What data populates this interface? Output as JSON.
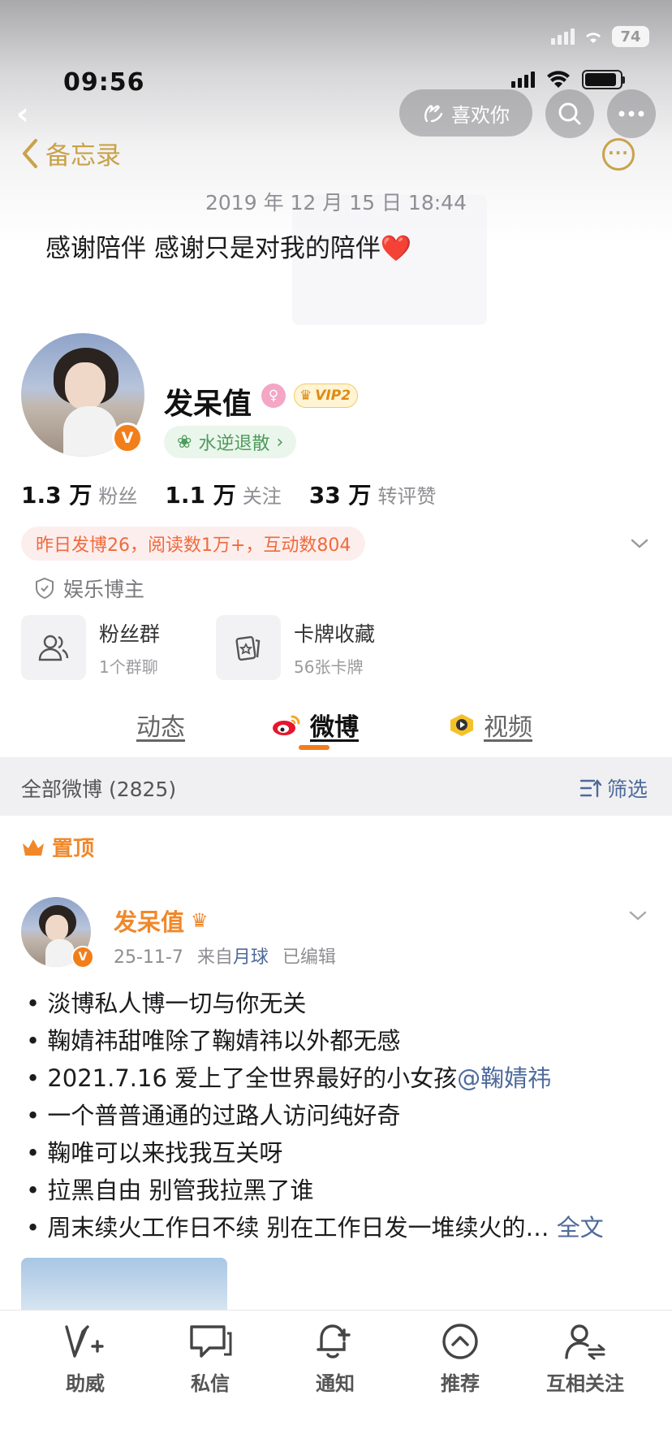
{
  "status_bar": {
    "time": "09:56",
    "battery_bg": "74"
  },
  "overlay_buttons": {
    "like_label": "喜欢你"
  },
  "memo": {
    "back_label": "备忘录",
    "date": "2019 年 12 月 15 日 18:44",
    "text": "感谢陪伴 感谢只是对我的陪伴❤️"
  },
  "profile": {
    "name": "发呆值",
    "vip_label": "VIP2",
    "tag": "水逆退散",
    "stats": [
      {
        "num": "1.3 万",
        "label": "粉丝"
      },
      {
        "num": "1.1 万",
        "label": "关注"
      },
      {
        "num": "33 万",
        "label": "转评赞"
      }
    ],
    "activity": "昨日发博26，阅读数1万+，互动数804",
    "certification": "娱乐博主",
    "cards": [
      {
        "title": "粉丝群",
        "subtitle": "1个群聊"
      },
      {
        "title": "卡牌收藏",
        "subtitle": "56张卡牌"
      }
    ]
  },
  "tabs": [
    {
      "label": "动态"
    },
    {
      "label": "微博"
    },
    {
      "label": "视频"
    }
  ],
  "filter_bar": {
    "all_label": "全部微博 (2825)",
    "filter_label": "筛选"
  },
  "pinned_label": "置顶",
  "post": {
    "author": "发呆值",
    "date": "25-11-7",
    "source_prefix": "来自",
    "source": "月球",
    "edited": "已编辑",
    "lines": [
      {
        "text": "• 淡博私人博一切与你无关"
      },
      {
        "text": "• 鞠婧祎甜唯除了鞠婧祎以外都无感"
      },
      {
        "text": "• 2021.7.16 爱上了全世界最好的小女孩",
        "mention": "@鞠婧祎"
      },
      {
        "text": "• 一个普普通通的过路人访问纯好奇"
      },
      {
        "text": "• 鞠唯可以来找我互关呀"
      },
      {
        "text": "• 拉黑自由 别管我拉黑了谁"
      },
      {
        "text": "• 周末续火工作日不续 别在工作日发一堆续火的…",
        "more": "全文"
      }
    ]
  },
  "bottom_nav": [
    {
      "label": "助威",
      "icon": "cheer-icon"
    },
    {
      "label": "私信",
      "icon": "message-icon"
    },
    {
      "label": "通知",
      "icon": "bell-icon"
    },
    {
      "label": "推荐",
      "icon": "recommend-icon"
    },
    {
      "label": "互相关注",
      "icon": "follow-icon"
    }
  ],
  "colors": {
    "accent": "#f27e1a",
    "memo_gold": "#c9a24a",
    "link_blue": "#4d6a9a"
  }
}
